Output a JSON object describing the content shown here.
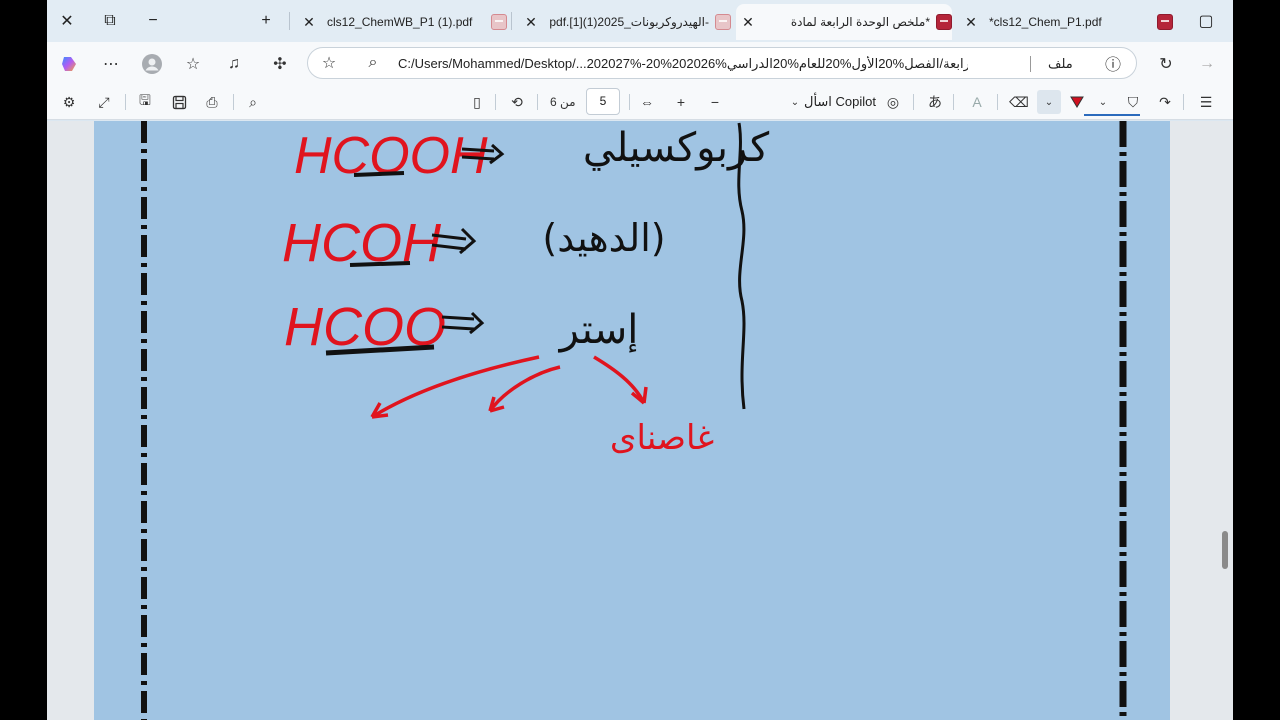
{
  "tabs": [
    {
      "title": "cls12_ChemWB_P1 (1).pdf",
      "active": false
    },
    {
      "title": "-الهيدروكربونات_2025(1)[1].pdf",
      "active": false
    },
    {
      "title": "*ملخص الوحدة الرابعة لمادة",
      "active": true
    },
    {
      "title": "*cls12_Chem_P1.pdf",
      "active": false
    }
  ],
  "address": {
    "url": "C:/Users/Mohammed/Desktop/...ملخ/الوحدة%20الرابعة/الفصل%20الأول%20للعام%20الدراسي%202026%20-%202027%",
    "file_label": "ملف"
  },
  "pdf_toolbar": {
    "current_page": "5",
    "page_count": "من 6",
    "copilot_label": "اسأل Copilot"
  },
  "annotations": {
    "formula_1": "HCOOH",
    "label_1": "كربوكسيلي",
    "formula_2": "HCOH",
    "label_2": "(الدهيد)",
    "formula_3": "HCOO",
    "label_3": "إستر",
    "label_4": "غاصناى"
  },
  "colors": {
    "page": "#a0c4e3",
    "ink_red": "#e0141e",
    "ink_black": "#111111",
    "accent": "#2b6bbd"
  }
}
